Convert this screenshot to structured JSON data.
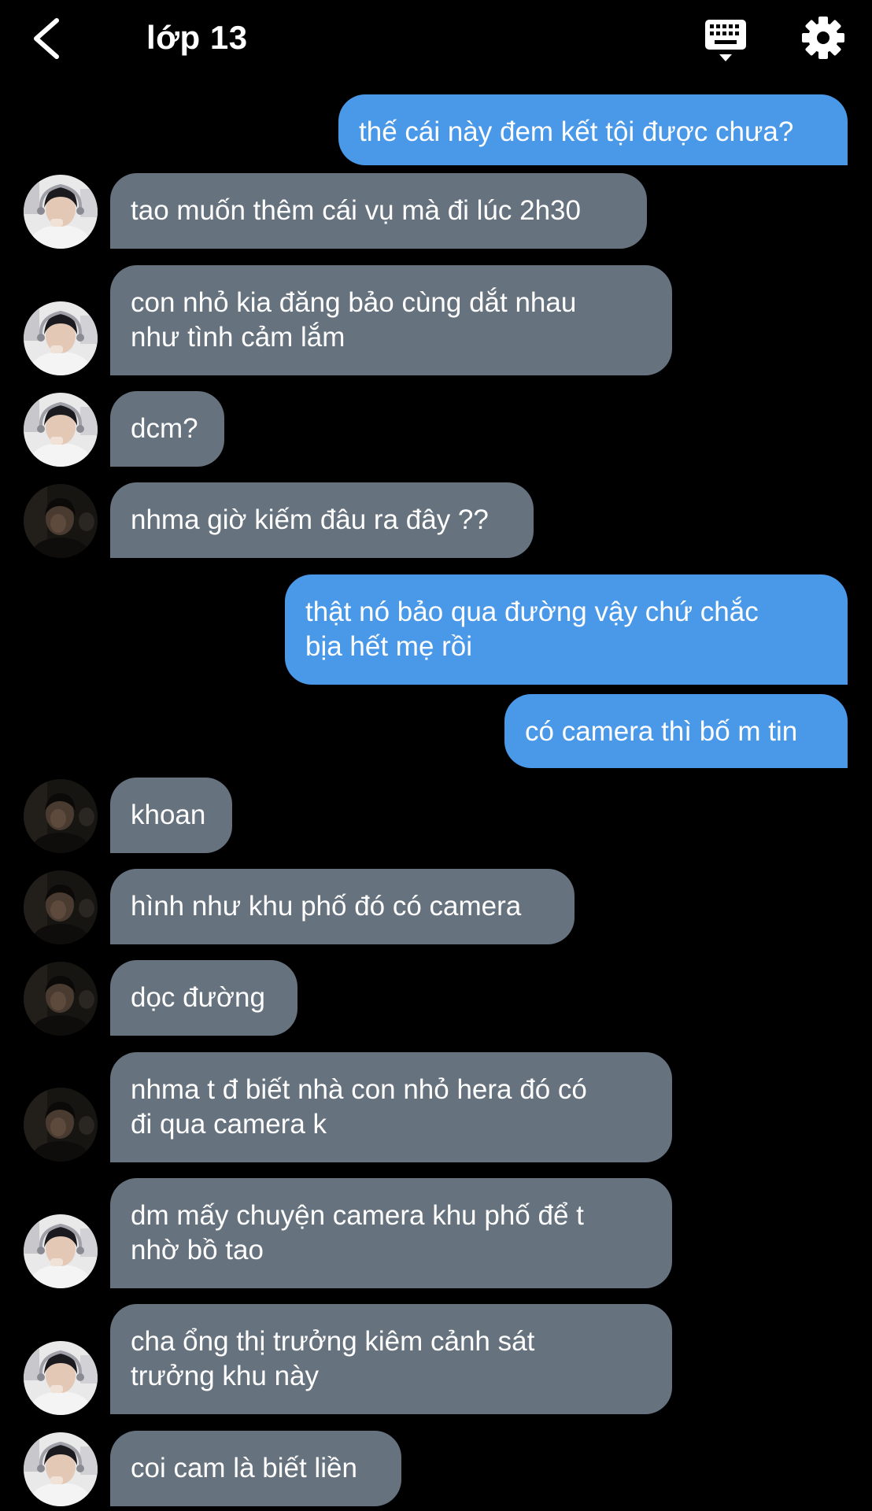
{
  "header": {
    "title": "lớp 13",
    "back_icon": "chevron-left-icon",
    "keyboard_icon": "keyboard-icon",
    "settings_icon": "gear-icon"
  },
  "colors": {
    "background": "#000000",
    "outgoing_bubble": "#4a98e8",
    "incoming_bubble": "#66727e",
    "text": "#ffffff"
  },
  "messages": [
    {
      "dir": "out",
      "text": "thế cái này đem kết tội được chưa?"
    },
    {
      "dir": "in",
      "avatar": "light",
      "text": "tao muốn thêm cái vụ mà đi lúc 2h30"
    },
    {
      "dir": "in",
      "avatar": "light",
      "text": "con nhỏ kia đăng bảo cùng dắt nhau\nnhư tình cảm lắm"
    },
    {
      "dir": "in",
      "avatar": "light",
      "text": "dcm?"
    },
    {
      "dir": "in",
      "avatar": "dark",
      "text": "nhma giờ kiếm đâu ra đây ??"
    },
    {
      "dir": "out",
      "text": "thật nó bảo qua đường vậy chứ chắc\nbịa hết mẹ rồi"
    },
    {
      "dir": "out",
      "text": "có camera thì bố m tin"
    },
    {
      "dir": "in",
      "avatar": "dark",
      "text": "khoan"
    },
    {
      "dir": "in",
      "avatar": "dark",
      "text": "hình như khu phố đó có camera"
    },
    {
      "dir": "in",
      "avatar": "dark",
      "text": "dọc đường"
    },
    {
      "dir": "in",
      "avatar": "dark",
      "text": "nhma t đ biết nhà con nhỏ hera đó có\nđi qua camera k"
    },
    {
      "dir": "in",
      "avatar": "light",
      "text": "dm mấy chuyện camera khu phố để t\nnhờ bồ tao"
    },
    {
      "dir": "in",
      "avatar": "light",
      "text": "cha ổng thị trưởng kiêm cảnh sát\ntrưởng khu này"
    },
    {
      "dir": "in",
      "avatar": "light",
      "text": "coi cam là biết liền"
    }
  ]
}
